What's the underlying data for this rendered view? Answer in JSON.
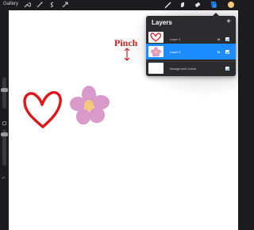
{
  "toolbar": {
    "gallery_label": "Gallery",
    "left_icons": [
      "wrench-icon",
      "magic-wand-icon",
      "selection-icon",
      "transform-arrow-icon"
    ],
    "right_icons": [
      "brush-icon",
      "smudge-icon",
      "eraser-icon",
      "layers-icon",
      "color-icon"
    ],
    "color_swatch": "#f5c97a",
    "accent": "#1c8cff"
  },
  "canvas": {
    "annotation_text": "Pinch",
    "annotation_color": "#d42020",
    "heart_color": "#e0161b",
    "flower_petal_color": "#d99ac9",
    "flower_center_color": "#f5c97a"
  },
  "layers_panel": {
    "title": "Layers",
    "add_symbol": "+",
    "layers": [
      {
        "name": "Layer 2",
        "blend": "N",
        "visible": true,
        "selected": false
      },
      {
        "name": "Layer 3",
        "blend": "N",
        "visible": true,
        "selected": true
      },
      {
        "name": "Background colour",
        "blend": "",
        "visible": true,
        "selected": false
      }
    ]
  }
}
